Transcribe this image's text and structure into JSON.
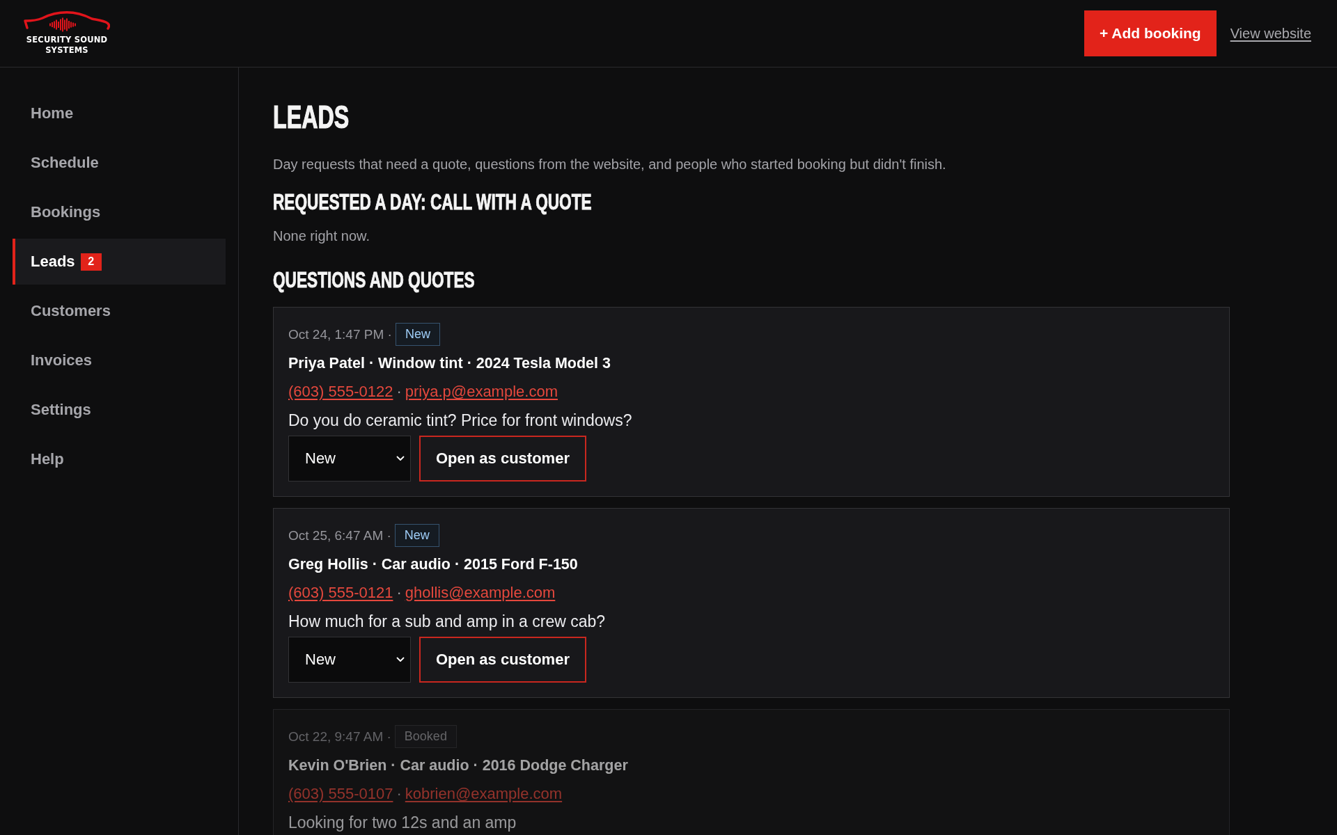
{
  "header": {
    "logo_lines": [
      "SECURITY SOUND",
      "SYSTEMS"
    ],
    "add_button": "+ Add booking",
    "view_link": "View website"
  },
  "sidebar": {
    "items": [
      {
        "label": "Home",
        "selected": false
      },
      {
        "label": "Schedule",
        "selected": false
      },
      {
        "label": "Bookings",
        "selected": false
      },
      {
        "label": "Leads",
        "selected": true,
        "badge": "2"
      },
      {
        "label": "Customers",
        "selected": false
      },
      {
        "label": "Invoices",
        "selected": false
      },
      {
        "label": "Settings",
        "selected": false
      },
      {
        "label": "Help",
        "selected": false
      }
    ]
  },
  "page": {
    "title": "LEADS",
    "description": "Day requests that need a quote, questions from the website, and people who started booking but didn't finish."
  },
  "sections": [
    {
      "heading": "REQUESTED A DAY: CALL WITH A QUOTE",
      "empty_text": "None right now."
    },
    {
      "heading": "QUESTIONS AND QUOTES",
      "leads": [
        {
          "kind": "new",
          "time": "Oct 24, 1:47 PM ·",
          "status": "New",
          "title": "Priya Patel · Window tint · 2024 Tesla Model 3",
          "phone": "(603) 555-0122",
          "separator": "·",
          "email": "priya.p@example.com",
          "message": "Do you do ceramic tint? Price for front windows?",
          "status_select": "New",
          "action": "Open as customer"
        },
        {
          "kind": "new",
          "time": "Oct 25, 6:47 AM ·",
          "status": "New",
          "title": "Greg Hollis · Car audio · 2015 Ford F-150",
          "phone": "(603) 555-0121",
          "separator": "·",
          "email": "ghollis@example.com",
          "message": "How much for a sub and amp in a crew cab?",
          "status_select": "New",
          "action": "Open as customer"
        },
        {
          "kind": "booked",
          "time": "Oct 22, 9:47 AM ·",
          "status": "Booked",
          "title": "Kevin O'Brien · Car audio · 2016 Dodge Charger",
          "phone": "(603) 555-0107",
          "separator": "·",
          "email": "kobrien@example.com",
          "message": "Looking for two 12s and an amp"
        }
      ]
    }
  ]
}
